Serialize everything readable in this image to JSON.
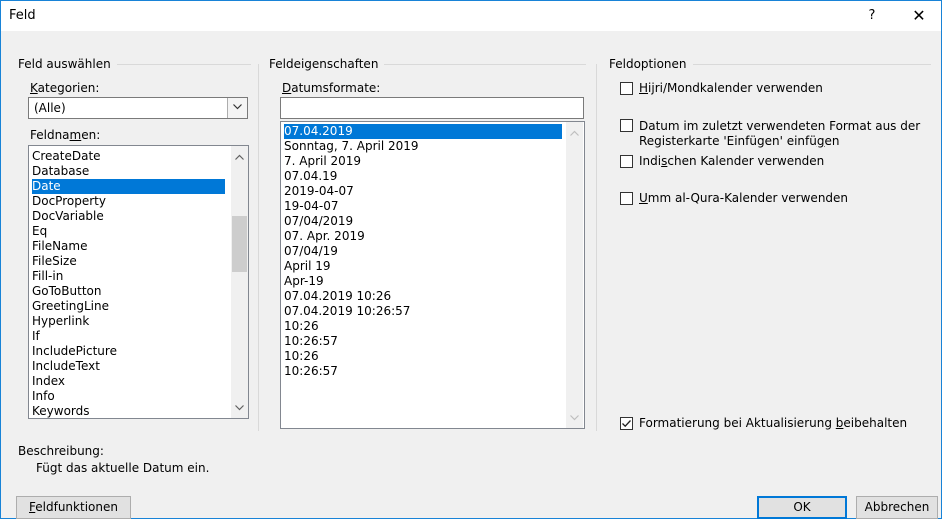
{
  "dialog": {
    "title": "Feld",
    "help": "?",
    "close": "✕"
  },
  "left": {
    "group_title": "Feld auswählen",
    "categories_label_u": "K",
    "categories_label_rest": "ategorien:",
    "category_value": "(Alle)",
    "fieldnames_label_pre": "Feldna",
    "fieldnames_label_u": "m",
    "fieldnames_label_post": "en:",
    "fieldnames": [
      "CreateDate",
      "Database",
      "Date",
      "DocProperty",
      "DocVariable",
      "Eq",
      "FileName",
      "FileSize",
      "Fill-in",
      "GoToButton",
      "GreetingLine",
      "Hyperlink",
      "If",
      "IncludePicture",
      "IncludeText",
      "Index",
      "Info",
      "Keywords"
    ],
    "selected_fieldname": "Date"
  },
  "middle": {
    "group_title": "Feldeigenschaften",
    "formats_label_u": "D",
    "formats_label_rest": "atumsformate:",
    "format_input_value": "",
    "formats": [
      "07.04.2019",
      "Sonntag, 7. April 2019",
      "7. April 2019",
      "07.04.19",
      "2019-04-07",
      "19-04-07",
      "07/04/2019",
      "07. Apr. 2019",
      "07/04/19",
      "April 19",
      "Apr-19",
      "07.04.2019 10:26",
      "07.04.2019 10:26:57",
      "10:26",
      "10:26:57",
      "10:26",
      "10:26:57"
    ],
    "selected_format": "07.04.2019"
  },
  "right": {
    "group_title": "Feldoptionen",
    "options": [
      {
        "pre": "",
        "u": "H",
        "post": "ijri/Mondkalender verwenden",
        "checked": false
      },
      {
        "pre": "Datum im zuletzt verwendeten Format aus der Registerkarte 'Einfügen' einfü",
        "u": "g",
        "post": "en",
        "checked": false
      },
      {
        "pre": "Indi",
        "u": "s",
        "post": "chen Kalender verwenden",
        "checked": false
      },
      {
        "pre": "",
        "u": "U",
        "post": "mm al-Qura-Kalender verwenden",
        "checked": false
      }
    ],
    "preserve": {
      "pre": "Formatierung bei Aktualisierung ",
      "u": "b",
      "post": "eibehalten",
      "checked": true
    }
  },
  "description": {
    "label": "Beschreibung:",
    "text": "Fügt das aktuelle Datum ein."
  },
  "buttons": {
    "field_codes_u": "F",
    "field_codes_rest": "eldfunktionen",
    "ok": "OK",
    "cancel": "Abbrechen"
  },
  "colors": {
    "accent": "#0078d7",
    "dialog_bg": "#f0f0f0"
  }
}
